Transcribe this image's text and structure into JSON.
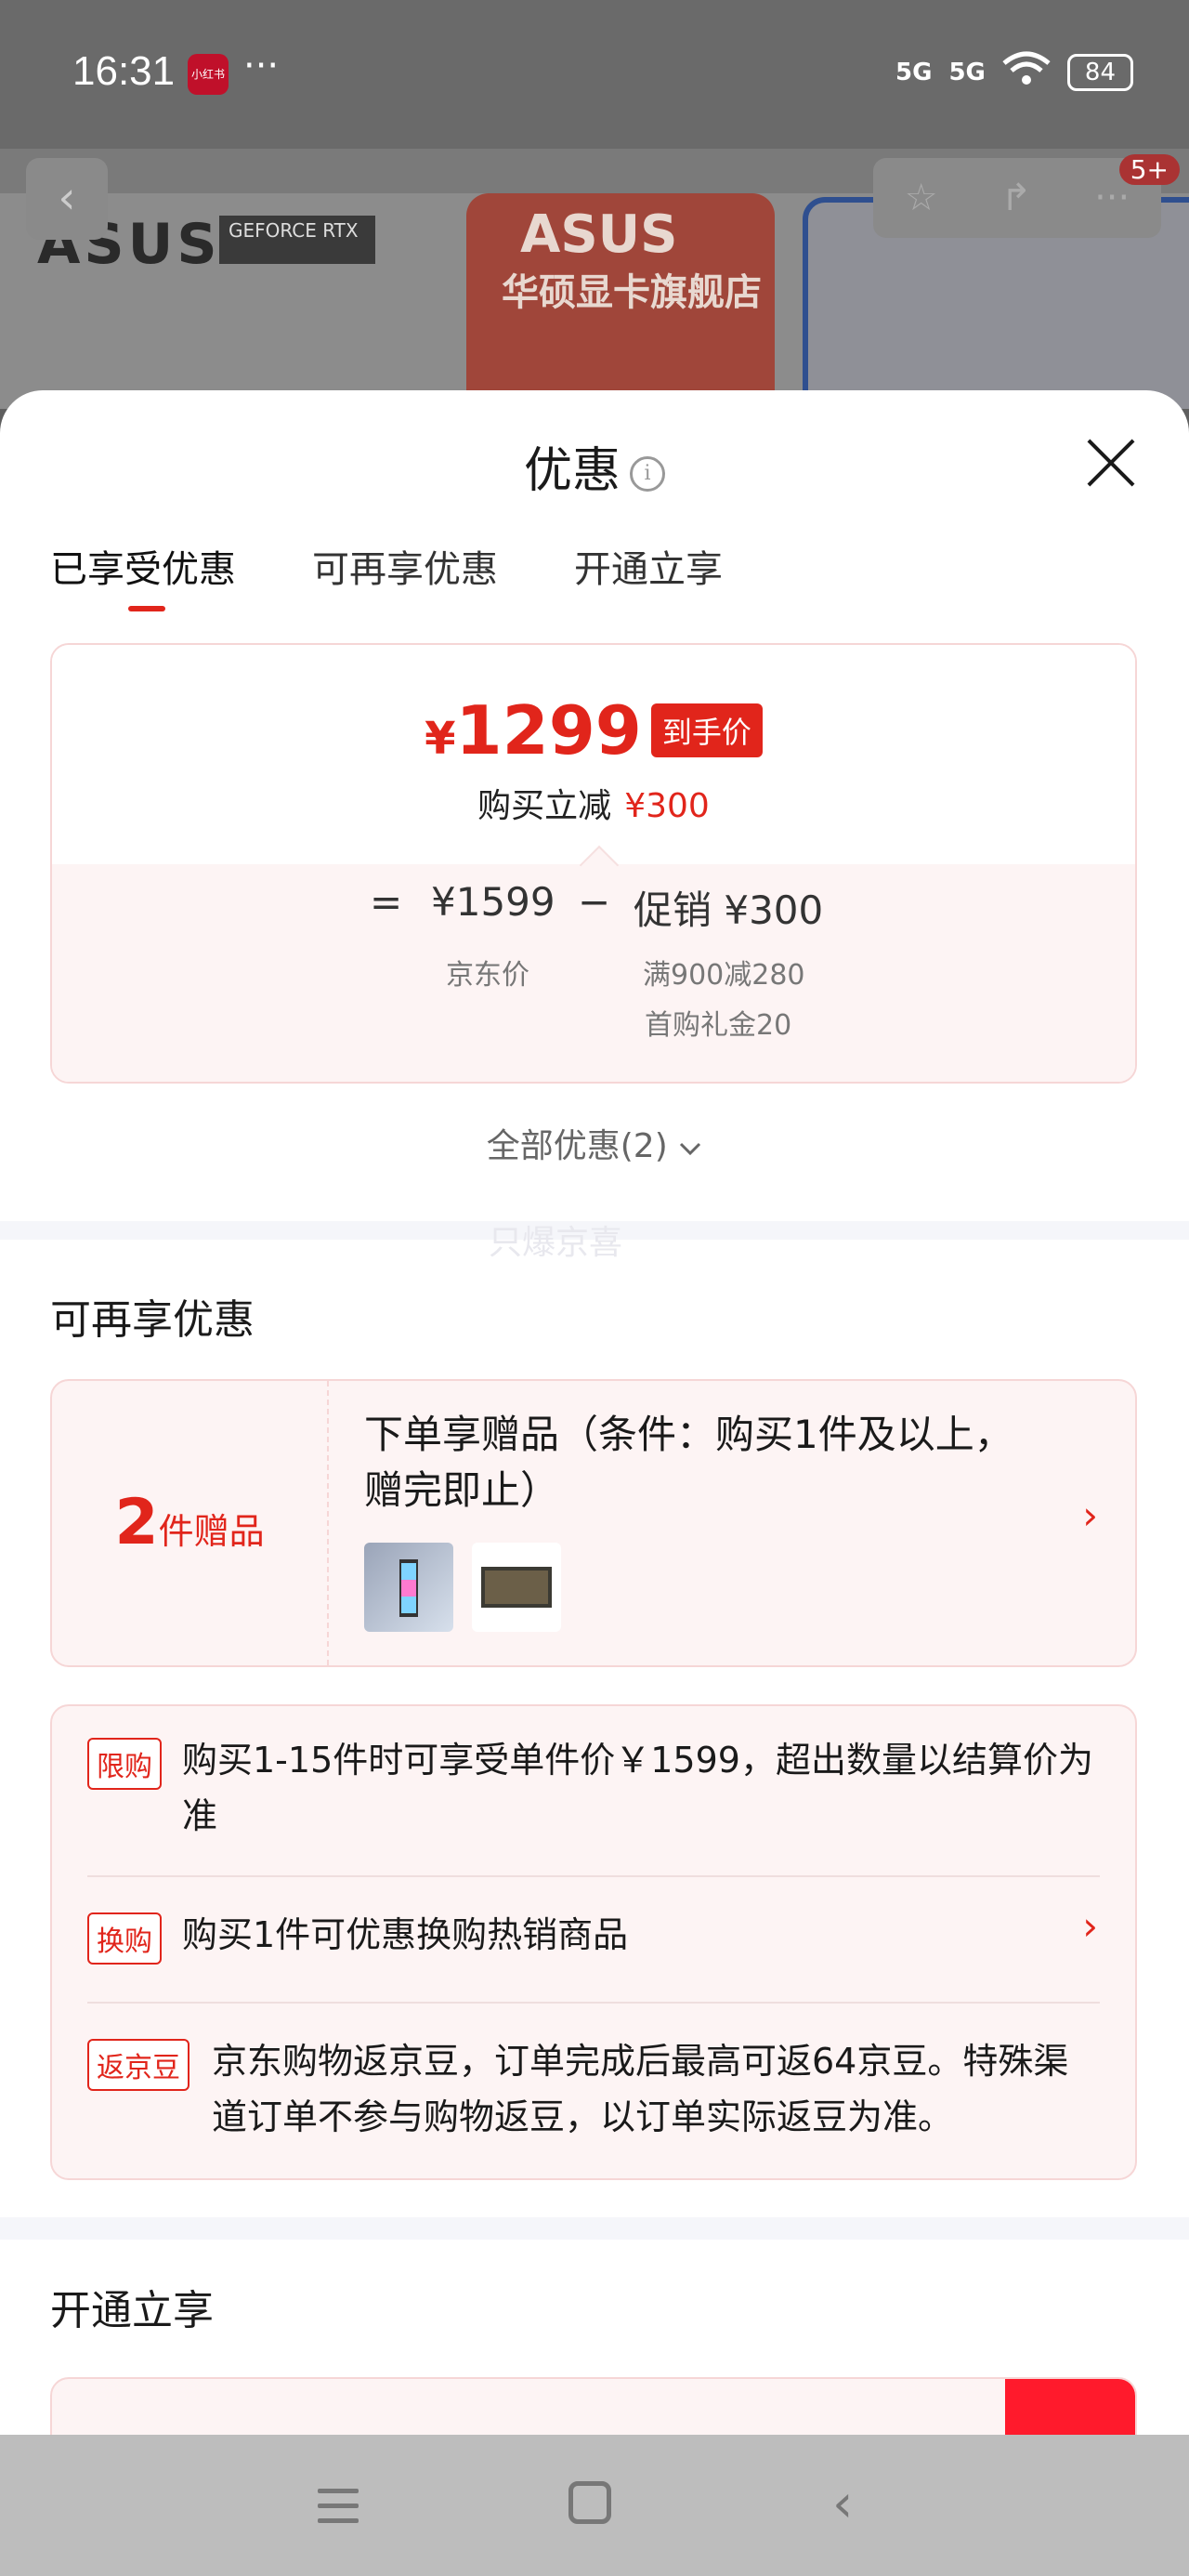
{
  "status_bar": {
    "time": "16:31",
    "app_badge": "小红书",
    "dots": "···",
    "net1": "5G",
    "net2": "5G",
    "battery": "84"
  },
  "background": {
    "brand": "ASUS",
    "gpu_badge": "GEFORCE RTX",
    "shop_brand": "ASUS",
    "shop_name": "华硕显卡旗舰店",
    "msg_count": "5+"
  },
  "sheet": {
    "title": "优惠",
    "tabs": [
      {
        "label": "已享受优惠",
        "active": true
      },
      {
        "label": "可再享优惠",
        "active": false
      },
      {
        "label": "开通立享",
        "active": false
      }
    ],
    "price": {
      "currency": "¥",
      "final": "1299",
      "tag": "到手价",
      "reduce_label": "购买立减",
      "reduce_value": "¥300",
      "eq": "=",
      "jd_price": "¥1599",
      "jd_label": "京东价",
      "minus": "−",
      "promo_label": "促销 ¥300",
      "promo_detail_1": "满900减280",
      "promo_detail_2": "首购礼金20"
    },
    "all_promos": "全部优惠(2)",
    "watermark": "只爆京喜"
  },
  "more_section": {
    "title": "可再享优惠",
    "gift": {
      "count": "2",
      "unit": "件赠品",
      "desc": "下单享赠品（条件：购买1件及以上，赠完即止）"
    },
    "rules": [
      {
        "tag": "限购",
        "text": "购买1-15件时可享受单件价￥1599，超出数量以结算价为准"
      },
      {
        "tag": "换购",
        "text": "购买1件可优惠换购热销商品"
      },
      {
        "tag": "返京豆",
        "text": "京东购物返京豆，订单完成后最高可返64京豆。特殊渠道订单不参与购物返豆，以订单实际返豆为准。"
      }
    ]
  },
  "open_section": {
    "title": "开通立享"
  },
  "colors": {
    "accent": "#e1251b",
    "card_bg": "#fdf4f4",
    "card_border": "#f6d6d6"
  }
}
